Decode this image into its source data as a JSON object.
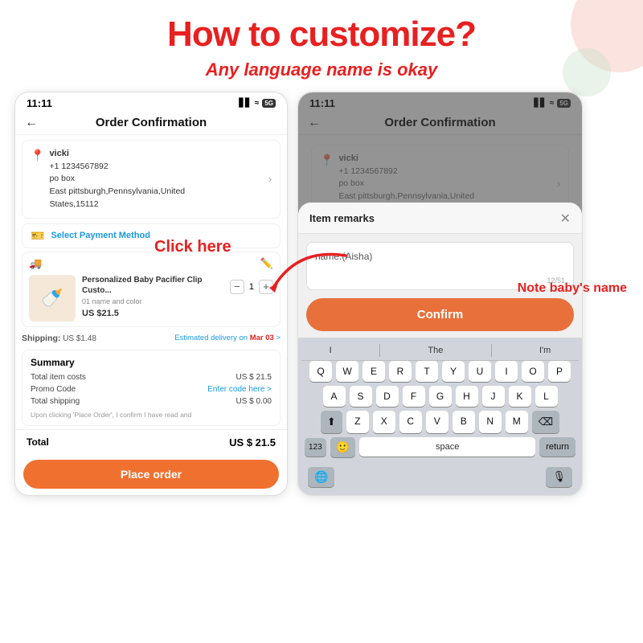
{
  "page": {
    "title": "How to customize?",
    "subtitle": "Any language name is okay"
  },
  "decorations": {
    "circle1": "top-right",
    "circle2": "inner-right"
  },
  "left_phone": {
    "status_bar": {
      "time": "11:11",
      "signal": "▋▋ ᅵ 5G"
    },
    "nav": {
      "back": "←",
      "title": "Order Confirmation"
    },
    "address": {
      "name": "vicki",
      "phone": "+1 1234567892",
      "line1": "po box",
      "line2": "East pittsburgh,Pennsylvania,United",
      "line3": "States,15112"
    },
    "payment": {
      "label": "Select Payment Method"
    },
    "product": {
      "name": "Personalized Baby Pacifier Clip Custo...",
      "variant": "01 name and color",
      "price": "US $21.5",
      "qty": "1"
    },
    "shipping": {
      "label": "Shipping:",
      "price": "US $1.48",
      "est": "Estimated delivery on Mar 03 >"
    },
    "summary": {
      "title": "Summary",
      "total_items_label": "Total item costs",
      "total_items_value": "US $ 21.5",
      "promo_label": "Promo Code",
      "promo_value": "Enter code here >",
      "total_shipping_label": "Total shipping",
      "total_shipping_value": "US $ 0.00",
      "note": "Upon clicking 'Place Order', I confirm I have read and"
    },
    "total": {
      "label": "Total",
      "value": "US $ 21.5"
    },
    "place_order": "Place order"
  },
  "right_phone": {
    "status_bar": {
      "time": "11:11",
      "signal": "▋▋ ᅵ 5G"
    },
    "nav": {
      "back": "←",
      "title": "Order Confirmation"
    },
    "modal": {
      "title": "Item remarks",
      "close": "✕",
      "input_text": "name:(Aisha)",
      "char_count": "12/51",
      "confirm_btn": "Confirm"
    },
    "keyboard": {
      "suggestions": [
        "I",
        "The",
        "I'm"
      ],
      "row1": [
        "Q",
        "W",
        "E",
        "R",
        "T",
        "Y",
        "U",
        "I",
        "O",
        "P"
      ],
      "row2": [
        "A",
        "S",
        "D",
        "F",
        "G",
        "H",
        "J",
        "K",
        "L"
      ],
      "row3": [
        "Z",
        "X",
        "C",
        "V",
        "B",
        "N",
        "M"
      ],
      "bottom": {
        "key123": "123",
        "space": "space",
        "return": "return"
      }
    }
  },
  "annotations": {
    "click_here": "Click here",
    "note_baby": "Note baby's name"
  }
}
